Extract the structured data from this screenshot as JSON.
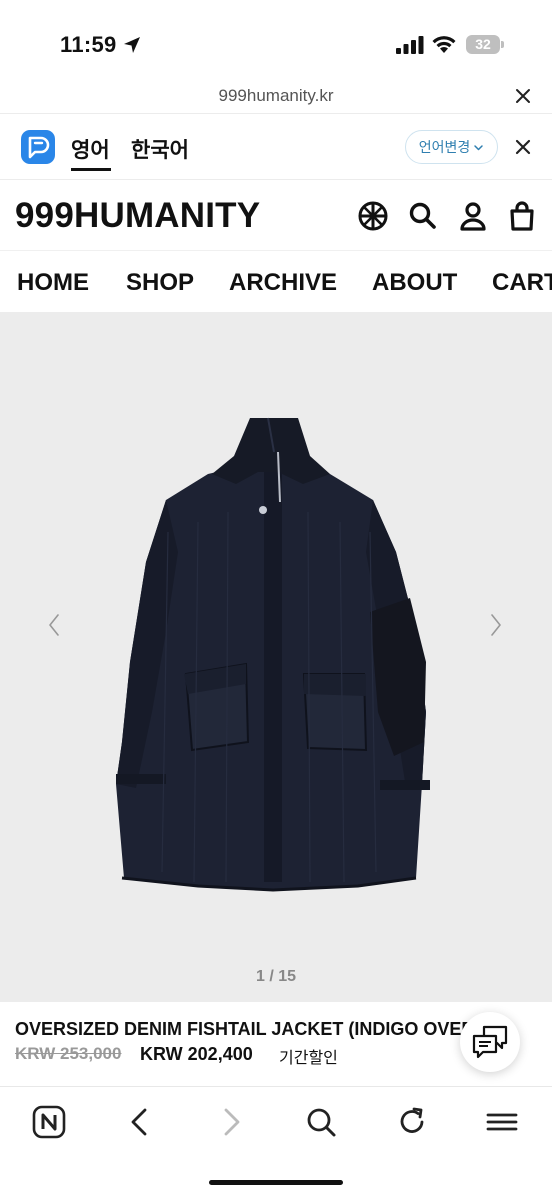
{
  "status_bar": {
    "time": "11:59",
    "battery": "32"
  },
  "browser": {
    "url": "999humanity.kr"
  },
  "translate_bar": {
    "tabs": [
      "영어",
      "한국어"
    ],
    "change_language_label": "언어변경"
  },
  "site": {
    "brand": "999HUMANITY",
    "nav": [
      "HOME",
      "SHOP",
      "ARCHIVE",
      "ABOUT",
      "CART"
    ]
  },
  "gallery": {
    "counter": "1 / 15"
  },
  "product": {
    "title": "OVERSIZED DENIM FISHTAIL JACKET (INDIGO OVERDYED)",
    "original_price": "KRW 253,000",
    "sale_price": "KRW 202,400",
    "badge": "기간할인"
  },
  "colors": {
    "accent_blue": "#2a86e8",
    "gallery_bg": "#ececec",
    "denim": "#1d2233"
  }
}
